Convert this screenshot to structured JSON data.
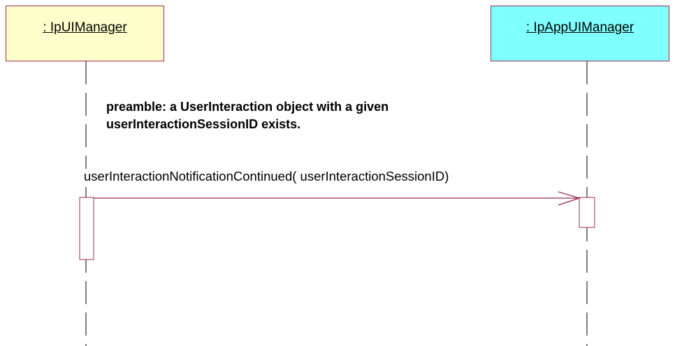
{
  "participants": [
    {
      "name": ": IpUIManager",
      "fill": "#ffffcc"
    },
    {
      "name": ": IpAppUIManager",
      "fill": "#80ffff"
    }
  ],
  "note": {
    "line1": "preamble: a UserInteraction object with a given",
    "line2": "userInteractionSessionID exists."
  },
  "message": {
    "label": "userInteractionNotificationContinued( userInteractionSessionID)",
    "from": ": IpUIManager",
    "to": ": IpAppUIManager"
  },
  "colors": {
    "border": "#9b2d4f",
    "lifeline": "#000000"
  }
}
